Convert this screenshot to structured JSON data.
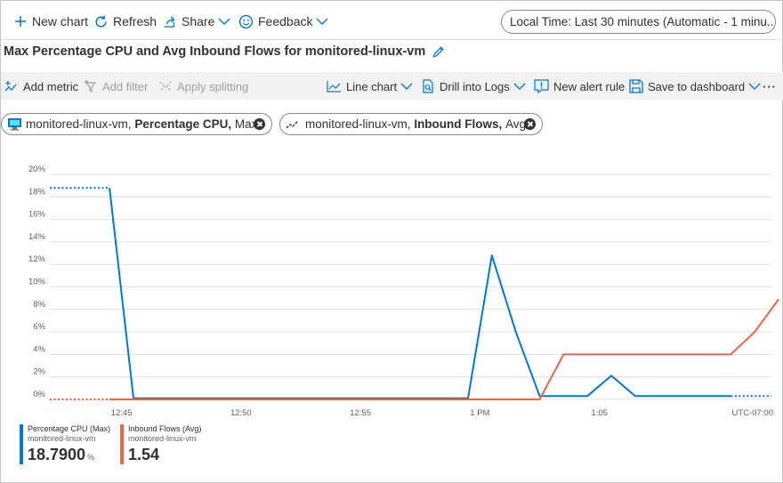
{
  "commands": {
    "new_chart": "New chart",
    "refresh": "Refresh",
    "share": "Share",
    "feedback": "Feedback",
    "time_range": "Local Time: Last 30 minutes (Automatic - 1 minu..."
  },
  "title": "Max Percentage CPU and Avg Inbound Flows for monitored-linux-vm",
  "toolbar": {
    "add_metric": "Add metric",
    "add_filter": "Add filter",
    "apply_splitting": "Apply splitting",
    "line_chart": "Line chart",
    "drill_logs": "Drill into Logs",
    "new_alert": "New alert rule",
    "save_dashboard": "Save to dashboard",
    "more": "···"
  },
  "pills": [
    {
      "resource": "monitored-linux-vm,",
      "metric": "Percentage CPU,",
      "agg": "Max"
    },
    {
      "resource": "monitored-linux-vm,",
      "metric": "Inbound Flows,",
      "agg": "Avg"
    }
  ],
  "chart_data": {
    "type": "line",
    "ylim": [
      0,
      20
    ],
    "y_ticks": [
      "0%",
      "2%",
      "4%",
      "6%",
      "8%",
      "10%",
      "12%",
      "14%",
      "16%",
      "18%",
      "20%"
    ],
    "x_ticks": [
      {
        "label": "12:45",
        "t": 3.9
      },
      {
        "label": "12:50",
        "t": 8.9
      },
      {
        "label": "12:55",
        "t": 13.9
      },
      {
        "label": "1 PM",
        "t": 18.9
      },
      {
        "label": "1:05",
        "t": 23.9
      }
    ],
    "x_range": [
      0.9,
      31.1
    ],
    "timezone": "UTC-07:00",
    "grid": true,
    "series": [
      {
        "name": "Percentage CPU (Max)",
        "resource": "monitored-linux-vm",
        "color": "#0078d4",
        "points": [
          [
            3.4,
            18.79
          ],
          [
            4.4,
            0.1
          ],
          [
            18.4,
            0.1
          ],
          [
            19.4,
            12.8
          ],
          [
            20.4,
            6.0
          ],
          [
            21.4,
            0.3
          ],
          [
            22.4,
            0.3
          ],
          [
            23.4,
            0.3
          ],
          [
            24.4,
            2.1
          ],
          [
            25.4,
            0.3
          ],
          [
            26.4,
            0.3
          ],
          [
            27.4,
            0.3
          ],
          [
            28.4,
            0.3
          ],
          [
            29.4,
            0.3
          ]
        ],
        "dotted_start": [
          [
            0.9,
            18.79
          ],
          [
            3.4,
            18.79
          ]
        ],
        "dotted_end": [
          [
            29.4,
            0.3
          ],
          [
            31.1,
            0.3
          ]
        ],
        "summary_value": "18.7900",
        "summary_unit": "%"
      },
      {
        "name": "Inbound Flows (Avg)",
        "resource": "monitored-linux-vm",
        "color": "#e8684a",
        "points": [
          [
            3.4,
            0
          ],
          [
            21.4,
            0
          ],
          [
            22.4,
            4.0
          ],
          [
            29.4,
            4.0
          ],
          [
            30.4,
            6.0
          ],
          [
            31.4,
            8.9
          ]
        ],
        "dotted_start": [
          [
            0.9,
            0
          ],
          [
            3.4,
            0
          ]
        ],
        "dotted_end": [],
        "summary_value": "1.54",
        "summary_unit": ""
      }
    ]
  },
  "colors": {
    "accent": "#0078d4",
    "cpu_series": "#0078d4",
    "flows_series": "#e8684a",
    "toolbar_bg": "#f3f2f1"
  }
}
